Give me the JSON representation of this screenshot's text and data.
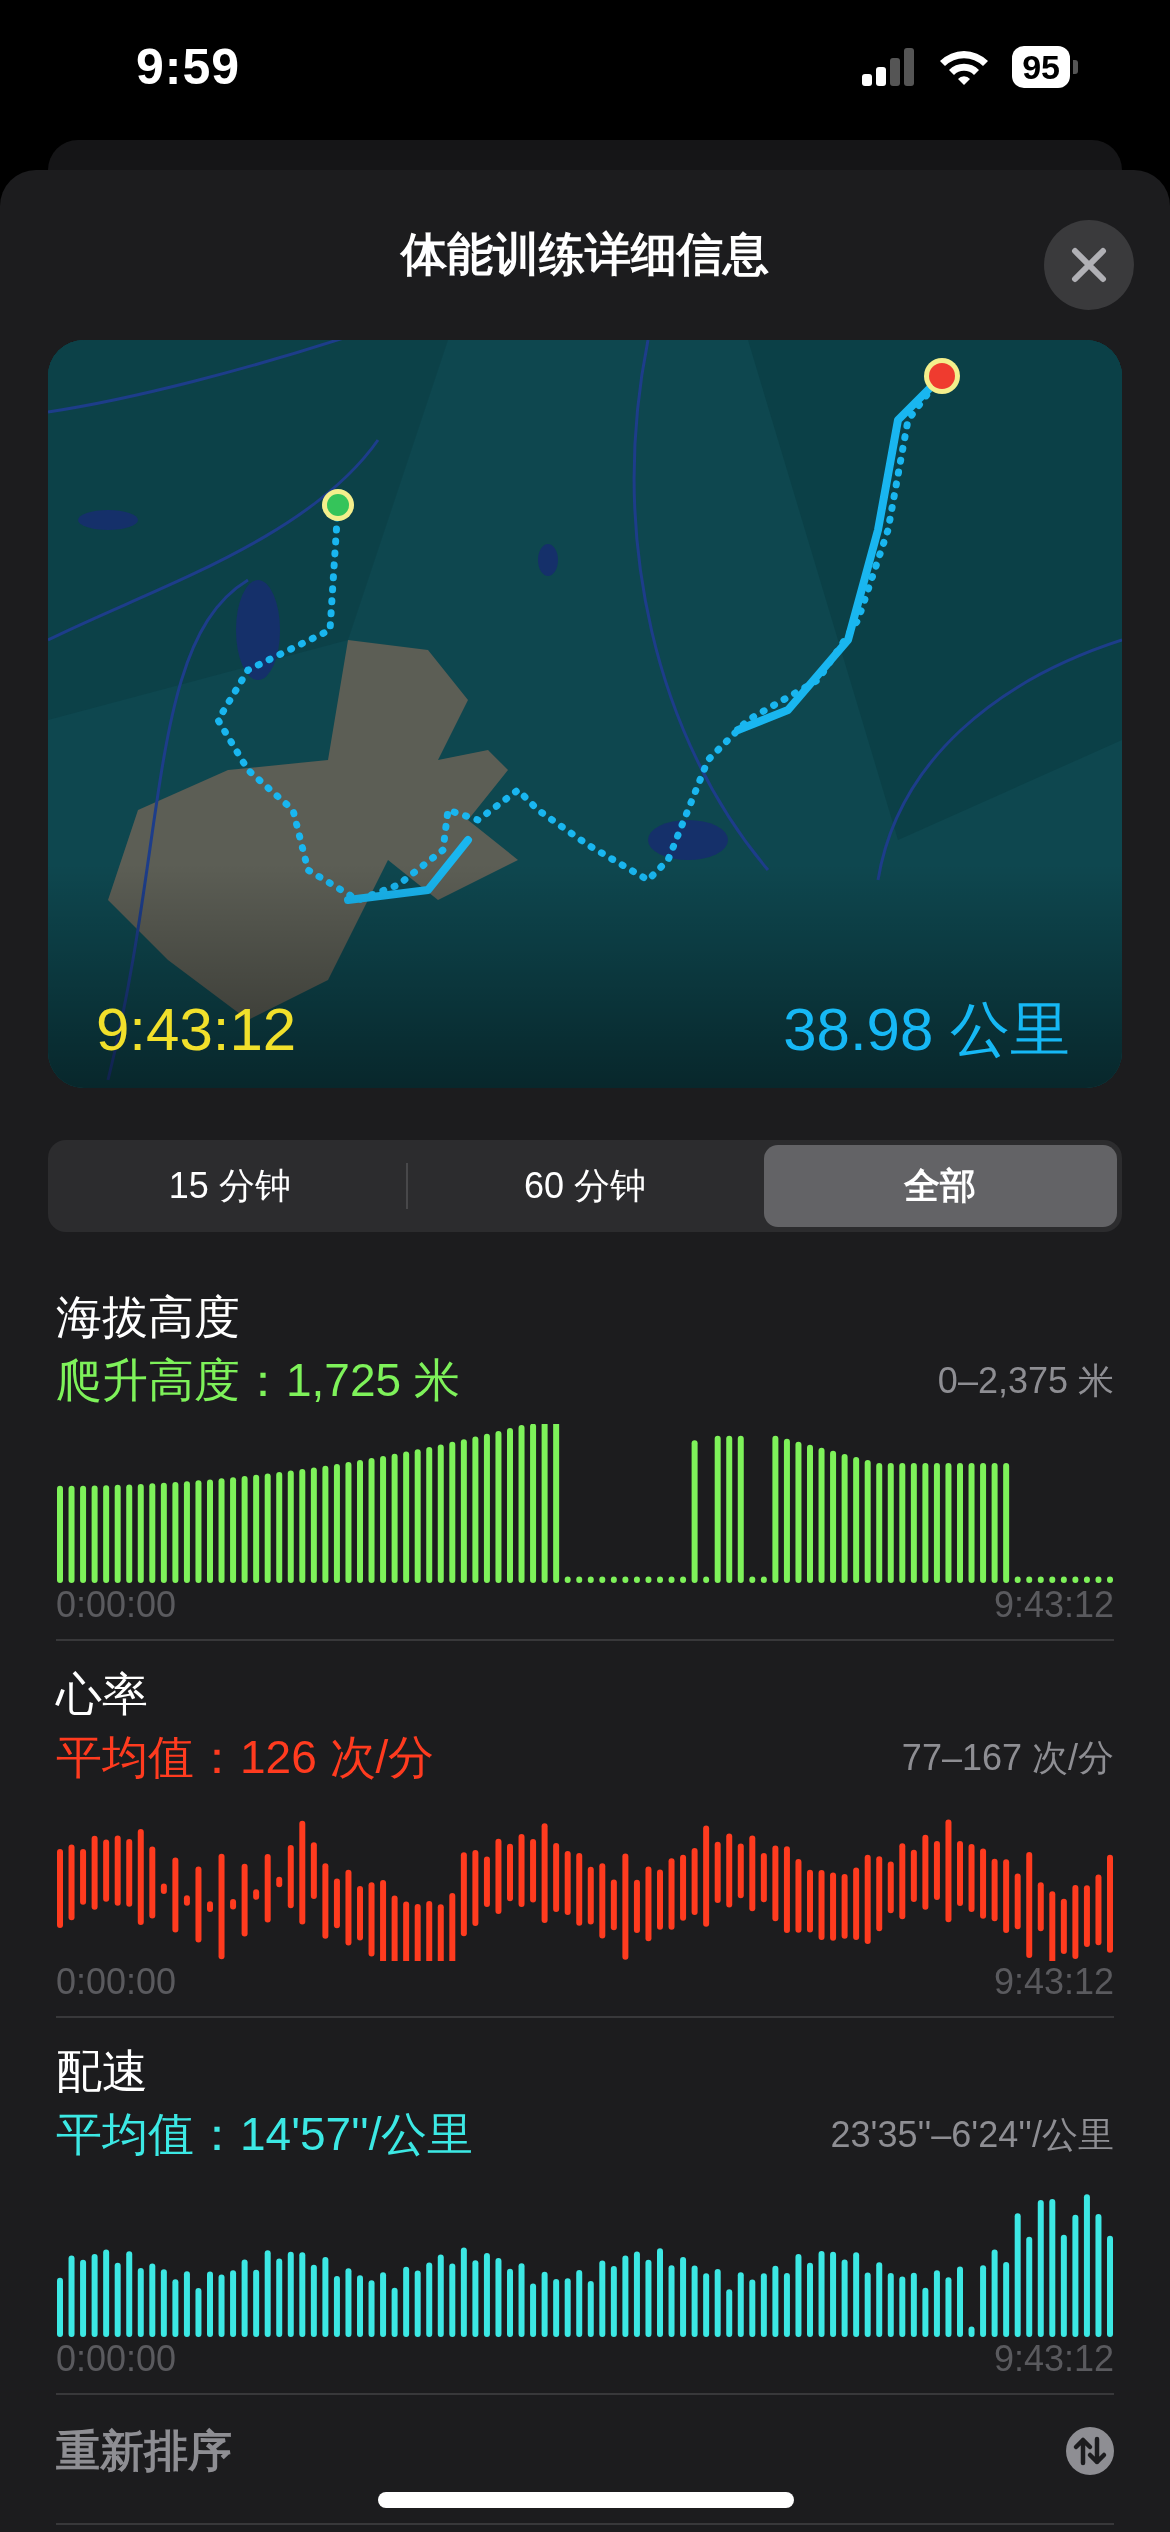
{
  "status_bar": {
    "time": "9:59",
    "battery": "95"
  },
  "sheet": {
    "title": "体能训练详细信息"
  },
  "map": {
    "kind": "picture",
    "duration": "9:43:12",
    "distance": "38.98 公里"
  },
  "range_tabs": [
    {
      "label": "15 分钟",
      "selected": false
    },
    {
      "label": "60 分钟",
      "selected": false
    },
    {
      "label": "全部",
      "selected": true
    }
  ],
  "metrics": [
    {
      "kind": "altitude",
      "title": "海拔高度",
      "summary": "爬升高度：1,725 米",
      "range": "0–2,375 米",
      "start": "0:00:00",
      "end": "9:43:12",
      "color": "#7ef25a"
    },
    {
      "kind": "heart_rate",
      "title": "心率",
      "summary": "平均值：126 次/分",
      "range": "77–167 次/分",
      "start": "0:00:00",
      "end": "9:43:12",
      "color": "#ff3b1f"
    },
    {
      "kind": "pace",
      "title": "配速",
      "summary": "平均值：14'57''/公里",
      "range": "23'35''–6'24''/公里",
      "start": "0:00:00",
      "end": "9:43:12",
      "color": "#3ce8e4"
    }
  ],
  "reorder": {
    "label": "重新排序"
  }
}
